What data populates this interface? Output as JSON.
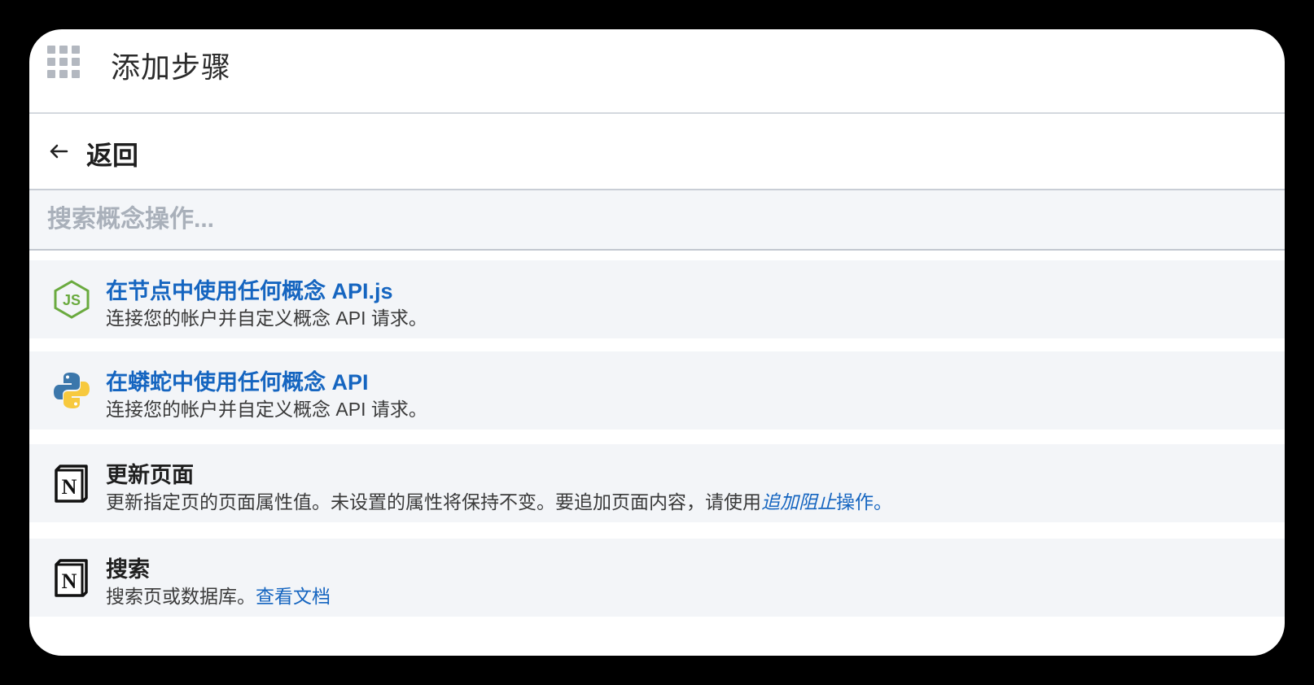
{
  "window": {
    "title": "添加步骤"
  },
  "nav": {
    "back_label": "返回"
  },
  "search": {
    "placeholder": "搜索概念操作..."
  },
  "actions": [
    {
      "icon": "nodejs-icon",
      "title": "在节点中使用任何概念 API.js",
      "desc": "连接您的帐户并自定义概念 API 请求。"
    },
    {
      "icon": "python-icon",
      "title": "在蟒蛇中使用任何概念 API",
      "desc": "连接您的帐户并自定义概念 API 请求。"
    },
    {
      "icon": "notion-icon",
      "title": "更新页面",
      "desc_prefix": "更新指定页的页面属性值。未设置的属性将保持不变。要追加页面内容，请使用",
      "desc_link_italic": "追加阻止",
      "desc_link": "操作",
      "desc_suffix": "。"
    },
    {
      "icon": "notion-icon",
      "title": "搜索",
      "desc_prefix": "搜索页或数据库。",
      "desc_link": "查看文档"
    }
  ],
  "colors": {
    "link": "#1565c0",
    "background": "#f3f5f8",
    "node_green": "#6aaa3f",
    "python_blue": "#3b77ab",
    "python_yellow": "#f7c93e"
  }
}
